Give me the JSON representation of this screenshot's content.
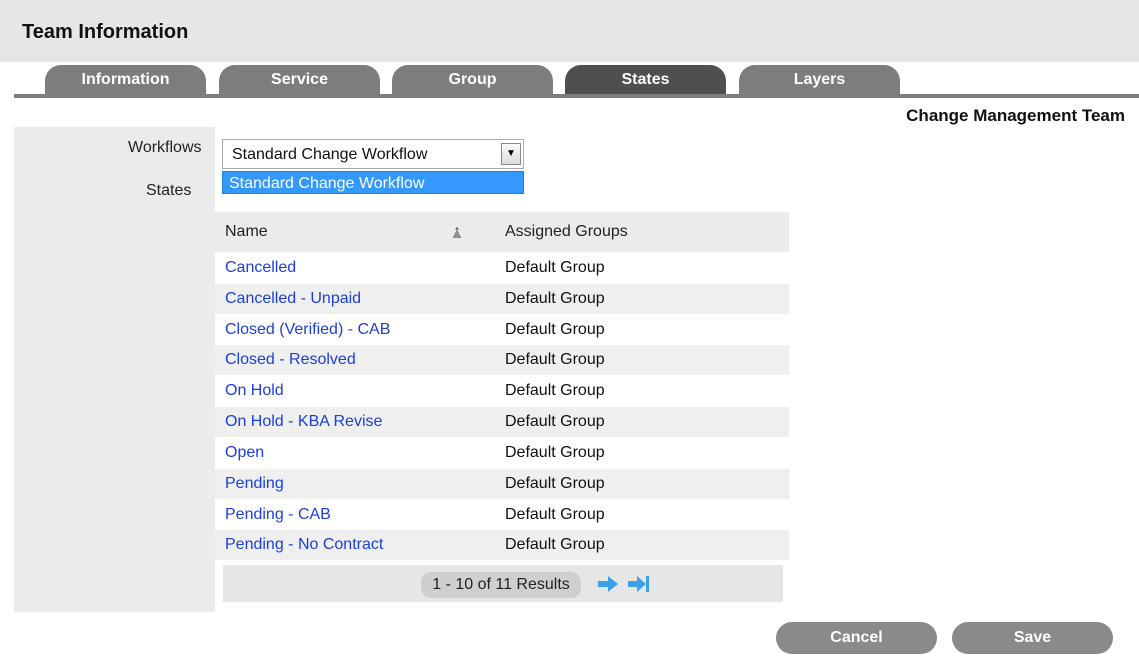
{
  "header": {
    "title": "Team Information"
  },
  "tabs": [
    {
      "label": "Information",
      "active": false
    },
    {
      "label": "Service",
      "active": false
    },
    {
      "label": "Group",
      "active": false
    },
    {
      "label": "States",
      "active": true
    },
    {
      "label": "Layers",
      "active": false
    }
  ],
  "team_name": "Change Management Team",
  "form": {
    "workflows_label": "Workflows",
    "states_label": "States",
    "workflow_select": {
      "value": "Standard Change Workflow",
      "options": [
        "Standard Change Workflow"
      ],
      "highlighted_option": "Standard Change Workflow"
    }
  },
  "table": {
    "columns": [
      "Name",
      "Assigned Groups"
    ],
    "rows": [
      {
        "name": "Cancelled",
        "group": "Default Group"
      },
      {
        "name": "Cancelled - Unpaid",
        "group": "Default Group"
      },
      {
        "name": "Closed (Verified) - CAB",
        "group": "Default Group"
      },
      {
        "name": "Closed - Resolved",
        "group": "Default Group"
      },
      {
        "name": "On Hold",
        "group": "Default Group"
      },
      {
        "name": "On Hold - KBA Revise",
        "group": "Default Group"
      },
      {
        "name": "Open",
        "group": "Default Group"
      },
      {
        "name": "Pending",
        "group": "Default Group"
      },
      {
        "name": "Pending - CAB",
        "group": "Default Group"
      },
      {
        "name": "Pending - No Contract",
        "group": "Default Group"
      }
    ]
  },
  "pager": {
    "summary": "1 - 10 of 11 Results",
    "next_icon": "next-arrow-icon",
    "last_icon": "last-page-arrow-icon"
  },
  "actions": {
    "cancel_label": "Cancel",
    "save_label": "Save"
  },
  "colors": {
    "link": "#1c3de0",
    "tab_active": "#4f4f4f",
    "tab_inactive": "#7d7d7d",
    "dropdown_highlight": "#3399ff",
    "pager_arrow": "#3aa0e8"
  }
}
